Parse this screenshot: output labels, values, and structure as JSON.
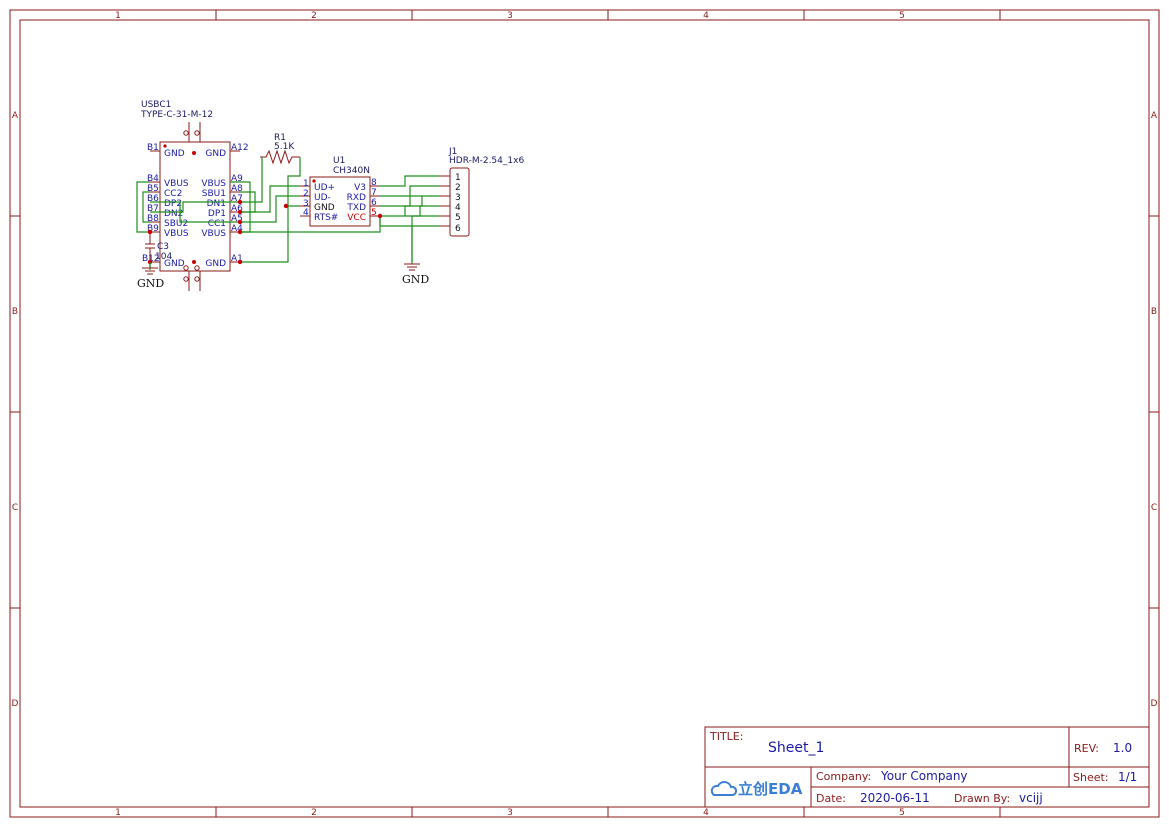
{
  "zones": {
    "columns": [
      "1",
      "2",
      "3",
      "4",
      "5"
    ],
    "rows": [
      "A",
      "B",
      "C",
      "D"
    ]
  },
  "usbc1": {
    "ref": "USBC1",
    "part": "TYPE-C-31-M-12",
    "left_pins": [
      {
        "num": "B1",
        "name": "GND"
      },
      {
        "num": "B4",
        "name": "VBUS"
      },
      {
        "num": "B5",
        "name": "CC2"
      },
      {
        "num": "B6",
        "name": "DP2"
      },
      {
        "num": "B7",
        "name": "DN2"
      },
      {
        "num": "B8",
        "name": "SBU2"
      },
      {
        "num": "B9",
        "name": "VBUS"
      },
      {
        "num": "B12",
        "name": "GND"
      }
    ],
    "right_pins": [
      {
        "num": "A12",
        "name": "GND"
      },
      {
        "num": "A9",
        "name": "VBUS"
      },
      {
        "num": "A8",
        "name": "SBU1"
      },
      {
        "num": "A7",
        "name": "DN1"
      },
      {
        "num": "A6",
        "name": "DP1"
      },
      {
        "num": "A5",
        "name": "CC1"
      },
      {
        "num": "A4",
        "name": "VBUS"
      },
      {
        "num": "A1",
        "name": "GND"
      }
    ]
  },
  "r1": {
    "ref": "R1",
    "value": "5.1K"
  },
  "c3": {
    "ref": "C3",
    "value": "104"
  },
  "u1": {
    "ref": "U1",
    "part": "CH340N",
    "left_pins": [
      {
        "num": "1",
        "name": "UD+"
      },
      {
        "num": "2",
        "name": "UD-"
      },
      {
        "num": "3",
        "name": "GND"
      },
      {
        "num": "4",
        "name": "RTS#"
      }
    ],
    "right_pins": [
      {
        "num": "8",
        "name": "V3"
      },
      {
        "num": "7",
        "name": "RXD"
      },
      {
        "num": "6",
        "name": "TXD"
      },
      {
        "num": "5",
        "name": "VCC"
      }
    ]
  },
  "j1": {
    "ref": "J1",
    "part": "HDR-M-2.54_1x6",
    "pins": [
      "1",
      "2",
      "3",
      "4",
      "5",
      "6"
    ]
  },
  "gnd_labels": [
    "GND",
    "GND"
  ],
  "title_block": {
    "title_label": "TITLE:",
    "title": "Sheet_1",
    "rev_label": "REV:",
    "rev": "1.0",
    "logo_text": "立创EDA",
    "company_label": "Company:",
    "company": "Your Company",
    "sheet_label": "Sheet:",
    "sheet": "1/1",
    "date_label": "Date:",
    "date": "2020-06-11",
    "drawn_label": "Drawn By:",
    "drawn": "vcijj"
  }
}
